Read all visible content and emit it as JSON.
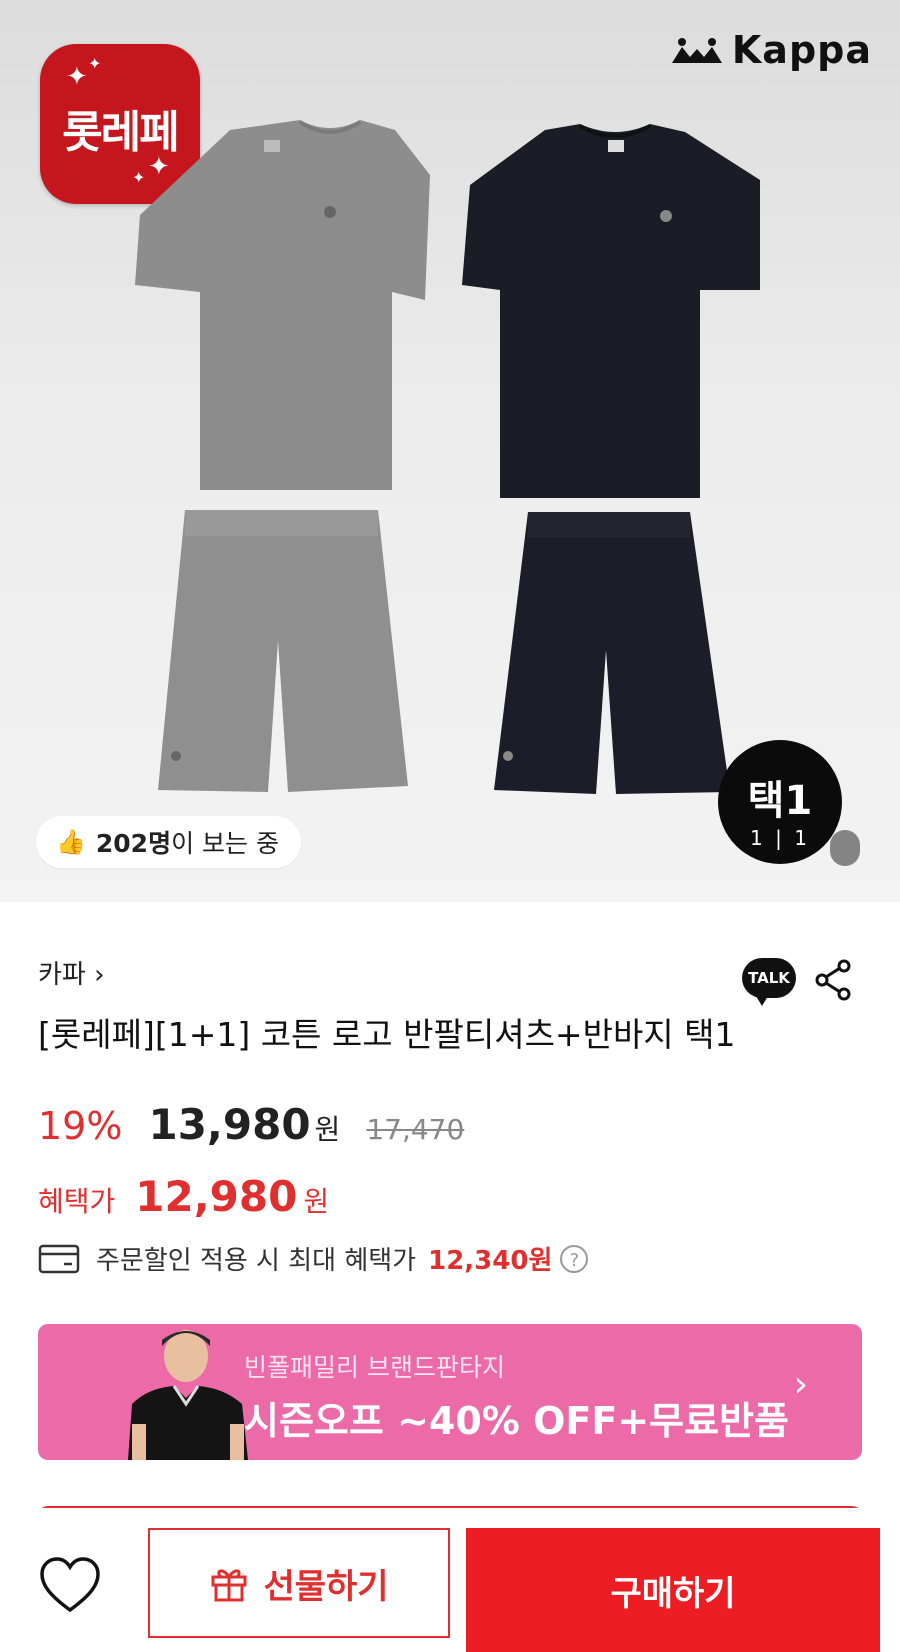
{
  "hero": {
    "brand_logo": "Kappa",
    "badge_text": "롯레페",
    "viewers_count": "202명",
    "viewers_suffix": "이 보는 중",
    "tag_title": "택1",
    "tag_pager": "1 | 1"
  },
  "product": {
    "brand": "카파 ›",
    "talk_label": "TALK",
    "title": "[롯레페][1+1] 코튼 로고 반팔티셔츠+반바지 택1",
    "discount": "19%",
    "price": "13,980",
    "won": "원",
    "original_price": "17,470",
    "benefit_label": "혜택가",
    "benefit_price": "12,980",
    "benefit_won": "원",
    "max_text": "주문할인 적용 시 최대 혜택가",
    "max_price": "12,340원",
    "help": "?"
  },
  "banner": {
    "sub": "빈폴패밀리 브랜드판타지",
    "main": "시즌오프 ~40% OFF+무료반품",
    "arrow": "›"
  },
  "bottom": {
    "gift_label": "선물하기",
    "buy_label": "구매하기"
  },
  "colors": {
    "accent": "#e02f2f",
    "buy": "#ec1e24",
    "banner": "#ed6aa8",
    "badge": "#c4161c"
  }
}
